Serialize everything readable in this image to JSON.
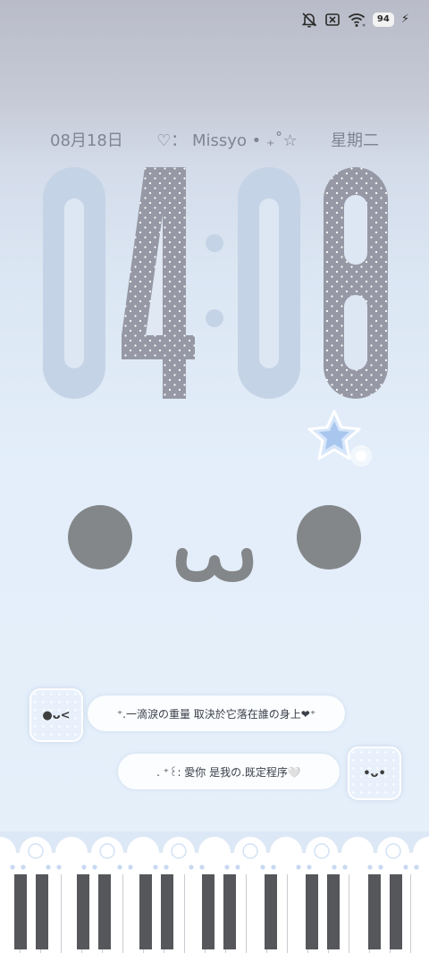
{
  "status_bar": {
    "icons": [
      "mute-icon",
      "no-sim-icon",
      "wifi-icon"
    ],
    "battery_level": "94",
    "charging": true
  },
  "lockscreen": {
    "date": "08月18日",
    "message": "♡： Missyo • ₊˚☆",
    "weekday": "星期二",
    "time": {
      "hour": "04",
      "minute": "08"
    }
  },
  "face": {
    "eyes": "two-grey-eyes",
    "mouth": "ω"
  },
  "chat": [
    {
      "avatar_face": "●ᴗ<",
      "text": "⁺.一滴淚の重量 取決於它落在誰の身上❤⁺"
    },
    {
      "avatar_face": "•ᴗ•",
      "text": ". ⁺꒰: 愛你 是我の.既定程序🤍"
    }
  ],
  "colors": {
    "dim_digit": "#c5d3e6",
    "dotted_digit": "#9699a5",
    "text_grey": "#7f8594",
    "eye": "#848789",
    "star": "#b9d1f0"
  }
}
